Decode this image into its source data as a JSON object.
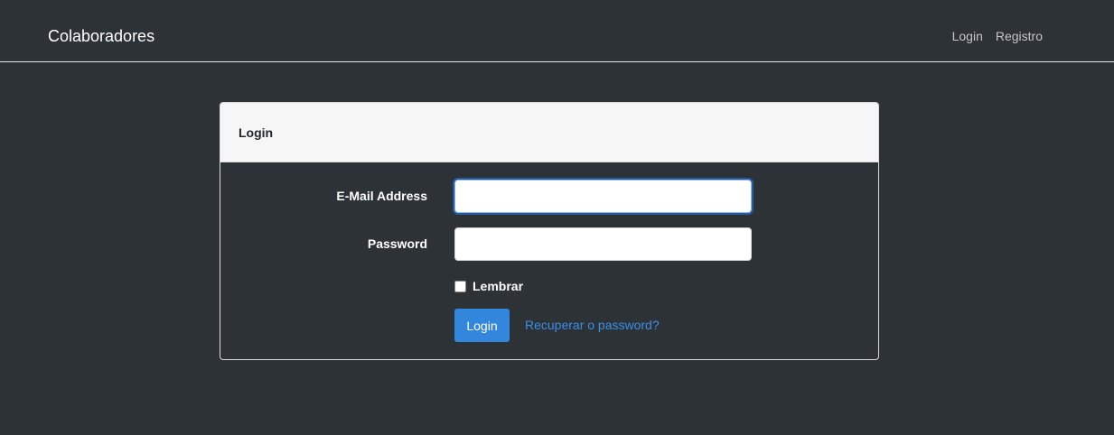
{
  "navbar": {
    "brand": "Colaboradores",
    "links": [
      {
        "label": "Login"
      },
      {
        "label": "Registro"
      }
    ]
  },
  "card": {
    "title": "Login",
    "email": {
      "label": "E-Mail Address",
      "value": "",
      "placeholder": ""
    },
    "password": {
      "label": "Password",
      "value": "",
      "placeholder": ""
    },
    "remember": {
      "label": "Lembrar",
      "checked": false
    },
    "submit_label": "Login",
    "forgot_label": "Recuperar o password?"
  },
  "colors": {
    "background": "#2d3237",
    "header_bg": "#f6f6f6",
    "primary": "#3287dc",
    "link": "#3a8fe6"
  }
}
